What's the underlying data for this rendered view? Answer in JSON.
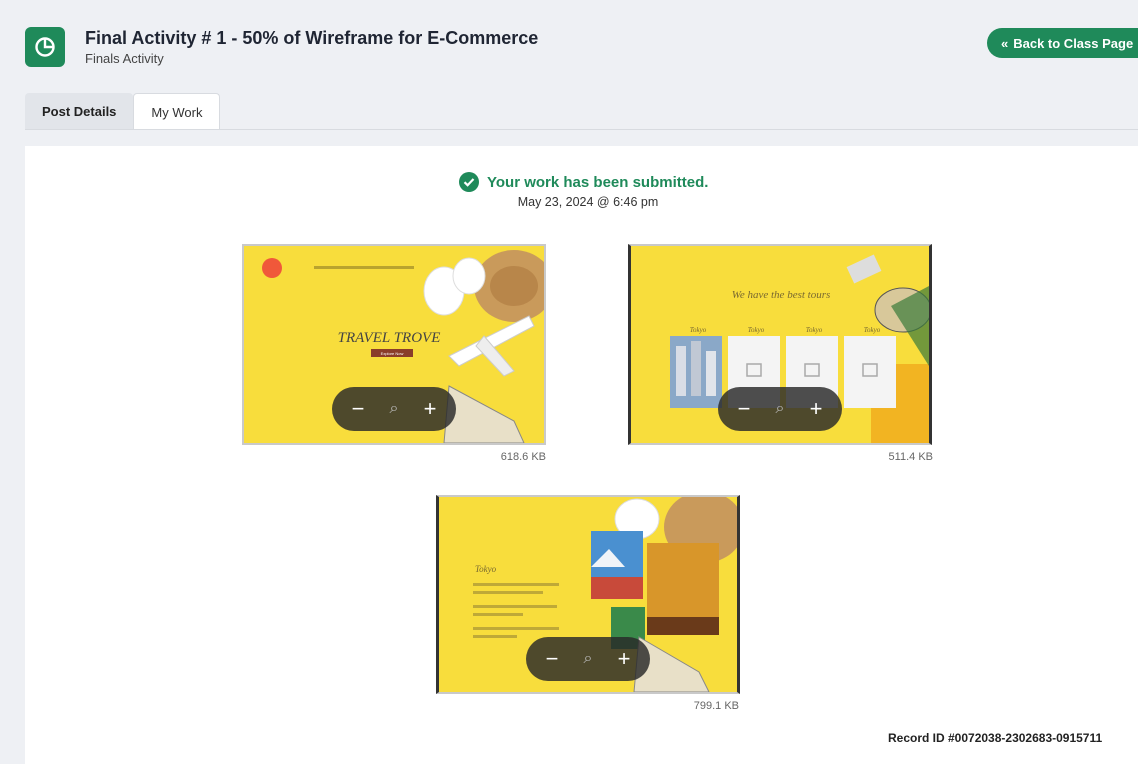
{
  "header": {
    "title": "Final Activity # 1 - 50% of Wireframe for E-Commerce",
    "subtitle": "Finals Activity",
    "back_label": "Back to Class Page"
  },
  "tabs": [
    {
      "label": "Post Details",
      "active": false
    },
    {
      "label": "My Work",
      "active": true
    }
  ],
  "submission": {
    "status": "Your work has been submitted.",
    "date": "May 23, 2024 @ 6:46 pm"
  },
  "attachments": [
    {
      "size": "618.6 KB",
      "headline": "TRAVEL TROVE",
      "cta": "Explore Now"
    },
    {
      "size": "511.4 KB",
      "headline": "We have the best tours",
      "card_labels": [
        "Tokyo",
        "Tokyo",
        "Tokyo",
        "Tokyo"
      ]
    },
    {
      "size": "799.1 KB",
      "headline": "Tokyo"
    }
  ],
  "zoom_controls": {
    "minus": "−",
    "zoom": "⌕",
    "plus": "+"
  },
  "record": "Record ID #0072038-2302683-0915711",
  "colors": {
    "accent": "#1f8a5a",
    "thumb_bg": "#f8d93a"
  }
}
